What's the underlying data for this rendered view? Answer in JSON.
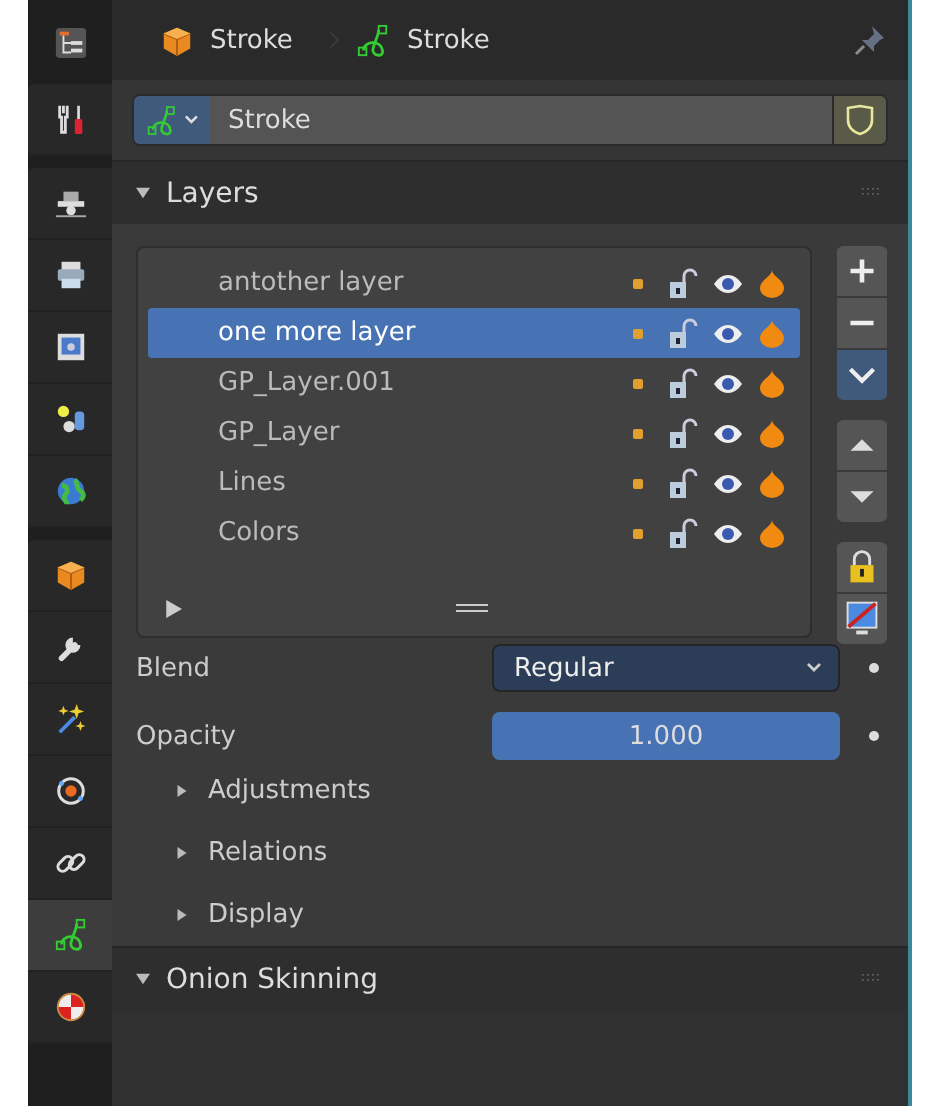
{
  "breadcrumb": [
    {
      "kind": "object",
      "label": "Stroke"
    },
    {
      "kind": "data",
      "label": "Stroke"
    }
  ],
  "pinned": false,
  "sidebar": {
    "tab_groups": [
      [
        {
          "kind": "tool",
          "selected": false
        }
      ],
      [
        {
          "kind": "render",
          "selected": false
        },
        {
          "kind": "output",
          "selected": false
        },
        {
          "kind": "view_layer",
          "selected": false
        },
        {
          "kind": "scene",
          "selected": false
        },
        {
          "kind": "world",
          "selected": false
        }
      ],
      [
        {
          "kind": "object",
          "selected": false
        },
        {
          "kind": "modifiers",
          "selected": false
        },
        {
          "kind": "effects",
          "selected": false
        },
        {
          "kind": "physics",
          "selected": false
        },
        {
          "kind": "constraints",
          "selected": false
        },
        {
          "kind": "data",
          "selected": true
        },
        {
          "kind": "material",
          "selected": false
        }
      ]
    ]
  },
  "datablock": {
    "name": "Stroke",
    "fake_user": true
  },
  "layers_panel": {
    "title": "Layers",
    "expanded": true,
    "layers": [
      {
        "name": "antother layer",
        "selected": false
      },
      {
        "name": "one more layer",
        "selected": true
      },
      {
        "name": "GP_Layer.001",
        "selected": false
      },
      {
        "name": "GP_Layer",
        "selected": false
      },
      {
        "name": "Lines",
        "selected": false
      },
      {
        "name": "Colors",
        "selected": false
      }
    ],
    "blend": {
      "label": "Blend",
      "value": "Regular"
    },
    "opacity": {
      "label": "Opacity",
      "value": "1.000",
      "level": 1
    },
    "subpanels": [
      {
        "title": "Adjustments",
        "expanded": false
      },
      {
        "title": "Relations",
        "expanded": false
      },
      {
        "title": "Display",
        "expanded": false
      }
    ]
  },
  "onion_panel": {
    "title": "Onion Skinning",
    "expanded": true
  }
}
